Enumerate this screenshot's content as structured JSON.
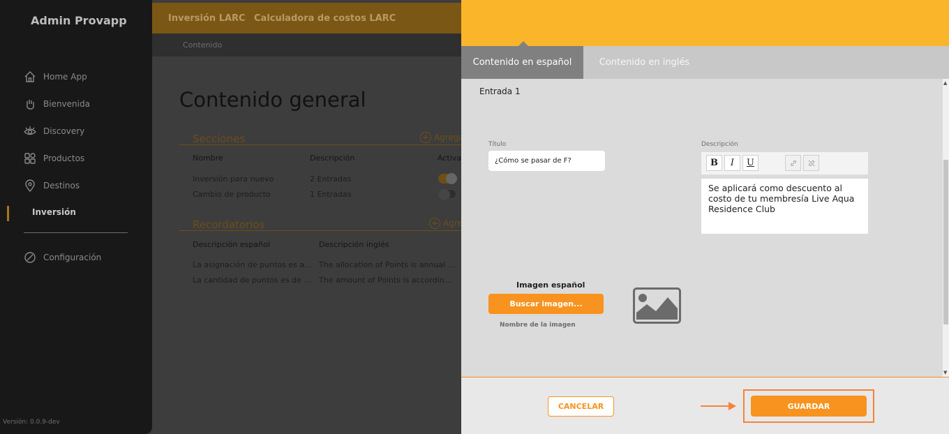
{
  "sidebar": {
    "brand": "Admin Provapp",
    "items": [
      {
        "label": "Home App",
        "icon": "home-icon"
      },
      {
        "label": "Bienvenida",
        "icon": "wave-hand-icon"
      },
      {
        "label": "Discovery",
        "icon": "eye-icon"
      },
      {
        "label": "Productos",
        "icon": "grid-icon"
      },
      {
        "label": "Destinos",
        "icon": "location-pin-icon"
      }
    ],
    "active_item": "Inversión",
    "config": {
      "label": "Configuración",
      "icon": "compass-icon"
    },
    "version": "Versión: 0.0.9-dev"
  },
  "background": {
    "tabs": [
      "Inversión LARC",
      "Calculadora de costos LARC"
    ],
    "breadcrumb": "Contenido",
    "heading": "Contenido general",
    "sections": {
      "title": "Secciones",
      "add_label": "Agregar",
      "headers": [
        "Nombre",
        "Descripción",
        "Activar"
      ],
      "rows": [
        {
          "name": "Inversión para nuevo",
          "description": "2 Entradas",
          "active": true
        },
        {
          "name": "Cambio de producto",
          "description": "1 Entradas",
          "active": false
        }
      ]
    },
    "reminders": {
      "title": "Recordatorios",
      "add_label": "Agregar",
      "headers": [
        "Descripción español",
        "Descripción inglés"
      ],
      "rows": [
        {
          "es": "La asignación de puntos es a...",
          "en": "The allocation of Points is annual ..."
        },
        {
          "es": "La cantidad de puntos es de ...",
          "en": "The amount of Points is accordin..."
        }
      ]
    }
  },
  "panel": {
    "colors": {
      "header": "#fbb52b",
      "accent": "#f7931e"
    },
    "tabs": {
      "spanish": "Contenido en español",
      "english": "Contenido en inglés"
    },
    "entry_label": "Entrada 1",
    "title_label": "Título",
    "title_value": "¿Cómo se pasar de F?",
    "description_label": "Descripción",
    "description_text": "Se aplicará como descuento al costo de tu membresía Live Aqua Residence Club",
    "toolbar": {
      "bold": "B",
      "italic": "I",
      "underline": "U"
    },
    "image_label": "Imagen español",
    "search_image_button": "Buscar imagen...",
    "image_name_label": "Nombre de la imagen",
    "cancel_button": "CANCELAR",
    "save_button": "GUARDAR"
  }
}
